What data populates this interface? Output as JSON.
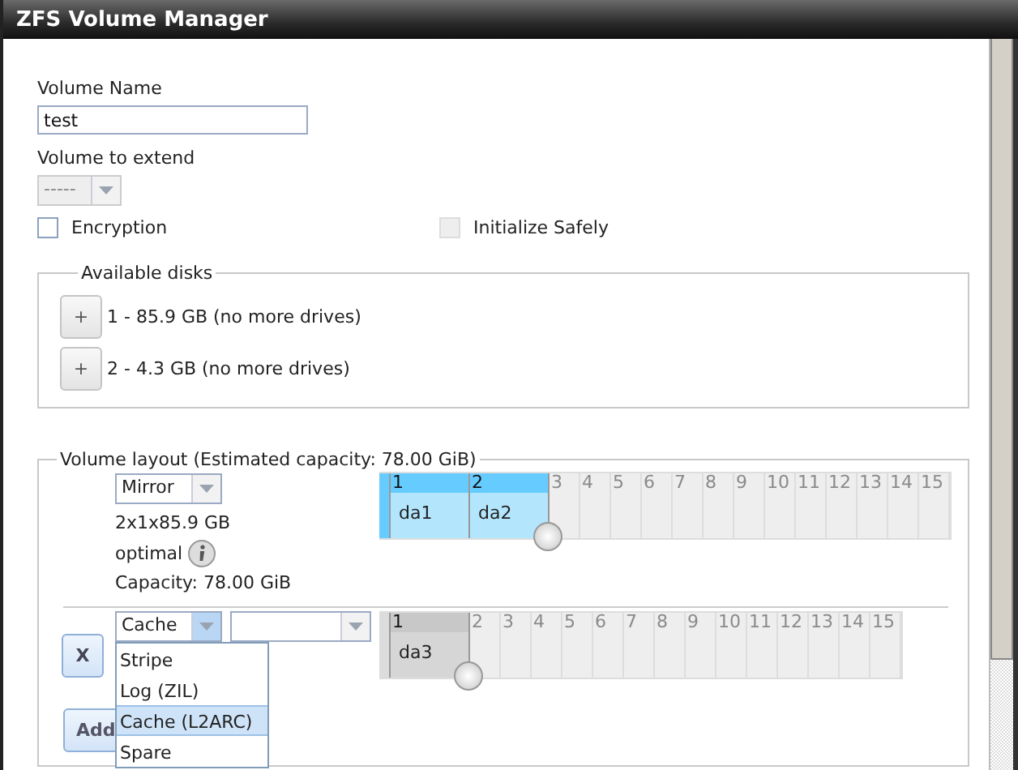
{
  "window": {
    "title": "ZFS Volume Manager"
  },
  "volume_name": {
    "label": "Volume Name",
    "value": "test"
  },
  "volume_to_extend": {
    "label": "Volume to extend",
    "value": "-----",
    "disabled": true
  },
  "options": [
    {
      "label": "Encryption",
      "checked": false,
      "disabled": false
    },
    {
      "label": "Initialize Safely",
      "checked": false,
      "disabled": true
    }
  ],
  "available_disks": {
    "legend": "Available disks",
    "items": [
      {
        "button": "+",
        "label": "1 - 85.9 GB (no more drives)"
      },
      {
        "button": "+",
        "label": "2 - 4.3 GB (no more drives)"
      }
    ]
  },
  "volume_layout": {
    "legend": "Volume layout (Estimated capacity: 78.00 GiB)",
    "vdevs": [
      {
        "kind": "data",
        "type": "Mirror",
        "summary": "2x1x85.9 GB",
        "status": "optimal",
        "capacity": "Capacity: 78.00 GiB",
        "slots": [
          "1",
          "2",
          "3",
          "4",
          "5",
          "6",
          "7",
          "8",
          "9",
          "10",
          "11",
          "12",
          "13",
          "14",
          "15"
        ],
        "disks": [
          "da1",
          "da2"
        ]
      },
      {
        "kind": "cache",
        "remove_button": "X",
        "type": "Cache",
        "option_select": true,
        "slots": [
          "1",
          "2",
          "3",
          "4",
          "5",
          "6",
          "7",
          "8",
          "9",
          "10",
          "11",
          "12",
          "13",
          "14",
          "15"
        ],
        "disks": [
          "da3"
        ],
        "dropdown": [
          {
            "label": "Stripe",
            "selected": false
          },
          {
            "label": "Log (ZIL)",
            "selected": false
          },
          {
            "label": "Cache (L2ARC)",
            "selected": true
          },
          {
            "label": "Spare",
            "selected": false
          }
        ]
      }
    ],
    "add_button": "Add"
  }
}
